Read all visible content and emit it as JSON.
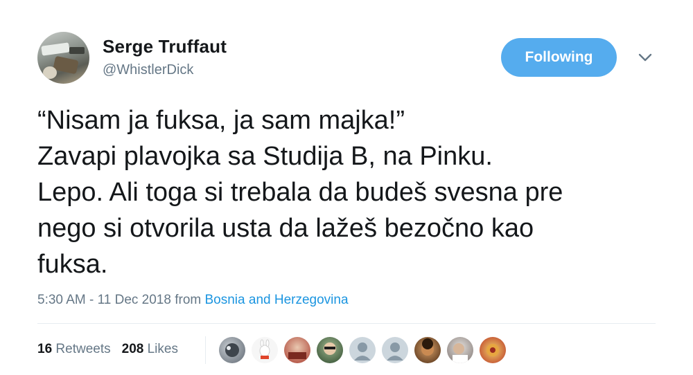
{
  "author": {
    "name": "Serge Truffaut",
    "handle": "@WhistlerDick"
  },
  "follow_button": {
    "label": "Following",
    "color": "#55acee"
  },
  "tweet": {
    "lines": [
      "“Nisam ja fuksa, ja sam majka!”",
      "Zavapi plavojka sa Studija B, na Pinku.",
      "Lepo. Ali toga si trebala da budeš svesna pre",
      "nego si otvorila usta da lažeš bezočno kao",
      "fuksa."
    ]
  },
  "meta": {
    "timestamp": "5:30 AM - 11 Dec 2018",
    "from_label": "from",
    "location": "Bosnia and Herzegovina"
  },
  "stats": {
    "retweets_count": "16",
    "retweets_label": "Retweets",
    "likes_count": "208",
    "likes_label": "Likes"
  },
  "likers": [
    {
      "icon": "liker-avatar-1",
      "color": "#6f7a86"
    },
    {
      "icon": "liker-avatar-2",
      "color": "#f4f4f4"
    },
    {
      "icon": "liker-avatar-3",
      "color": "#b84a3a"
    },
    {
      "icon": "liker-avatar-4",
      "color": "#3a5f3a"
    },
    {
      "icon": "default-egg-avatar",
      "color": "#c8d1d9"
    },
    {
      "icon": "default-egg-avatar",
      "color": "#c8d1d9"
    },
    {
      "icon": "liker-avatar-7",
      "color": "#8a5a2b"
    },
    {
      "icon": "liker-avatar-8",
      "color": "#9a9090"
    },
    {
      "icon": "liker-avatar-9",
      "color": "#c43c2f"
    }
  ],
  "icons": {
    "chevron": "chevron-down-icon"
  }
}
